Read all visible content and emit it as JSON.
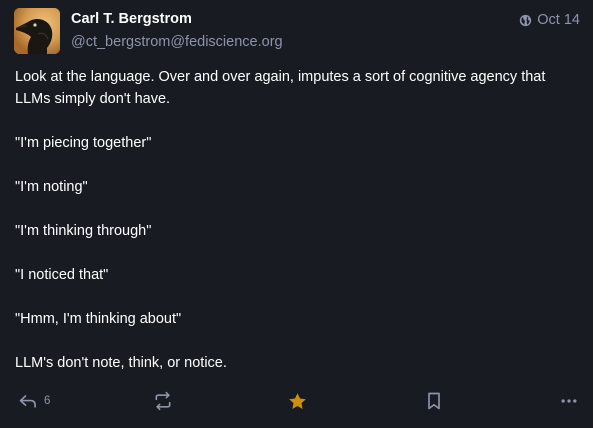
{
  "author": {
    "display_name": "Carl T. Bergstrom",
    "handle": "@ct_bergstrom@fediscience.org",
    "avatar_icon": "crow-avatar"
  },
  "meta": {
    "visibility_icon": "globe-icon",
    "date": "Oct 14"
  },
  "content": {
    "paragraphs": [
      "Look at the language. Over and over again, imputes a sort of cognitive agency that LLMs simply don't have.",
      "\"I'm piecing together\"",
      "\"I'm noting\"",
      "\"I'm thinking through\"",
      "\"I noticed that\"",
      "\"Hmm, I'm thinking about\"",
      "LLM's don't note, think, or notice."
    ]
  },
  "actions": {
    "reply_count": "6",
    "reply_icon": "reply-icon",
    "boost_icon": "boost-icon",
    "favourite_icon": "star-icon",
    "bookmark_icon": "bookmark-icon",
    "more_icon": "ellipsis-icon"
  },
  "colors": {
    "background": "#191b22",
    "text": "#ffffff",
    "muted": "#8d93ab",
    "favourite_active": "#ca8f04"
  }
}
